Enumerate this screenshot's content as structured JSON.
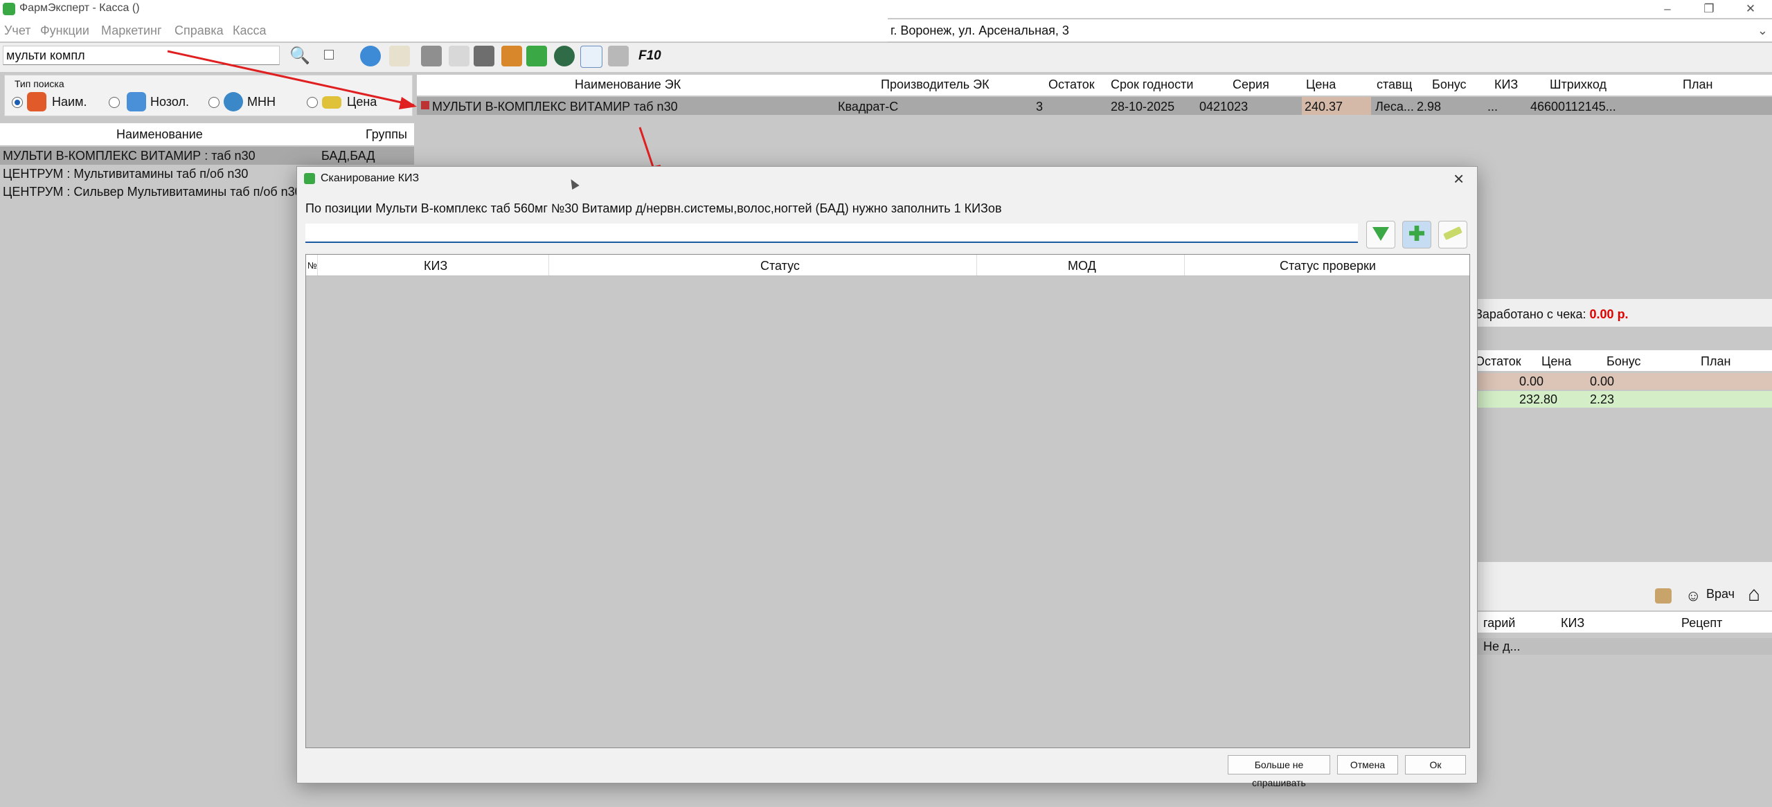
{
  "window": {
    "title": "ФармЭксперт - Касса ()"
  },
  "menu": [
    "Учет",
    "Функции",
    "Маркетинг",
    "Справка",
    "Касса"
  ],
  "address": "г. Воронеж, ул. Арсенальная, 3",
  "search": {
    "value": "мульти компл"
  },
  "toolbar": {
    "f10_label": "F10"
  },
  "search_type": {
    "legend": "Тип поиска",
    "options": [
      "Наим.",
      "Нозол.",
      "МНН",
      "Цена"
    ]
  },
  "left_list": {
    "columns": [
      "Наименование",
      "Группы"
    ],
    "rows": [
      {
        "name": "МУЛЬТИ В-КОМПЛЕКС ВИТАМИР : таб n30",
        "group": "БАД,БАД"
      },
      {
        "name": "ЦЕНТРУМ : Мультивитамины таб п/об n30",
        "group": ""
      },
      {
        "name": "ЦЕНТРУМ : Сильвер Мультивитамины таб п/об n30",
        "group": ""
      }
    ]
  },
  "main_grid": {
    "columns": [
      "Наименование ЭК",
      "Производитель ЭК",
      "Остаток",
      "Срок годности",
      "Серия",
      "Цена",
      "ставщ",
      "Бонус",
      "КИЗ",
      "Штрихкод",
      "План"
    ],
    "row": {
      "name": "МУЛЬТИ В-КОМПЛЕКС ВИТАМИР таб n30",
      "manufacturer": "Квадрат-С",
      "stock": "3",
      "expiry": "28-10-2025",
      "series": "0421023",
      "price": "240.37",
      "supplier": "Леса...",
      "bonus": "2.98",
      "kiz": "...",
      "barcode": "46600112145..."
    }
  },
  "receipt": {
    "earned_label": "Заработано с чека:",
    "earned_value": "0.00 р.",
    "columns": [
      "Остаток",
      "Цена",
      "Бонус",
      "План"
    ],
    "rows": [
      {
        "price": "0.00",
        "bonus": "0.00"
      },
      {
        "price": "232.80",
        "bonus": "2.23"
      }
    ]
  },
  "bottom": {
    "doctor_label": "Врач",
    "columns": [
      "гарий",
      "КИЗ",
      "Рецепт"
    ],
    "row_value": "Не д..."
  },
  "dialog": {
    "title": "Сканирование КИЗ",
    "message": "По позиции Мульти В-комплекс таб 560мг №30 Витамир д/нервн.системы,волос,ногтей (БАД) нужно заполнить 1 КИЗов",
    "columns": [
      "№",
      "КИЗ",
      "Статус",
      "МОД",
      "Статус проверки"
    ],
    "buttons": {
      "dont_ask": "Больше не спрашивать",
      "cancel": "Отмена",
      "ok": "Ок"
    }
  }
}
